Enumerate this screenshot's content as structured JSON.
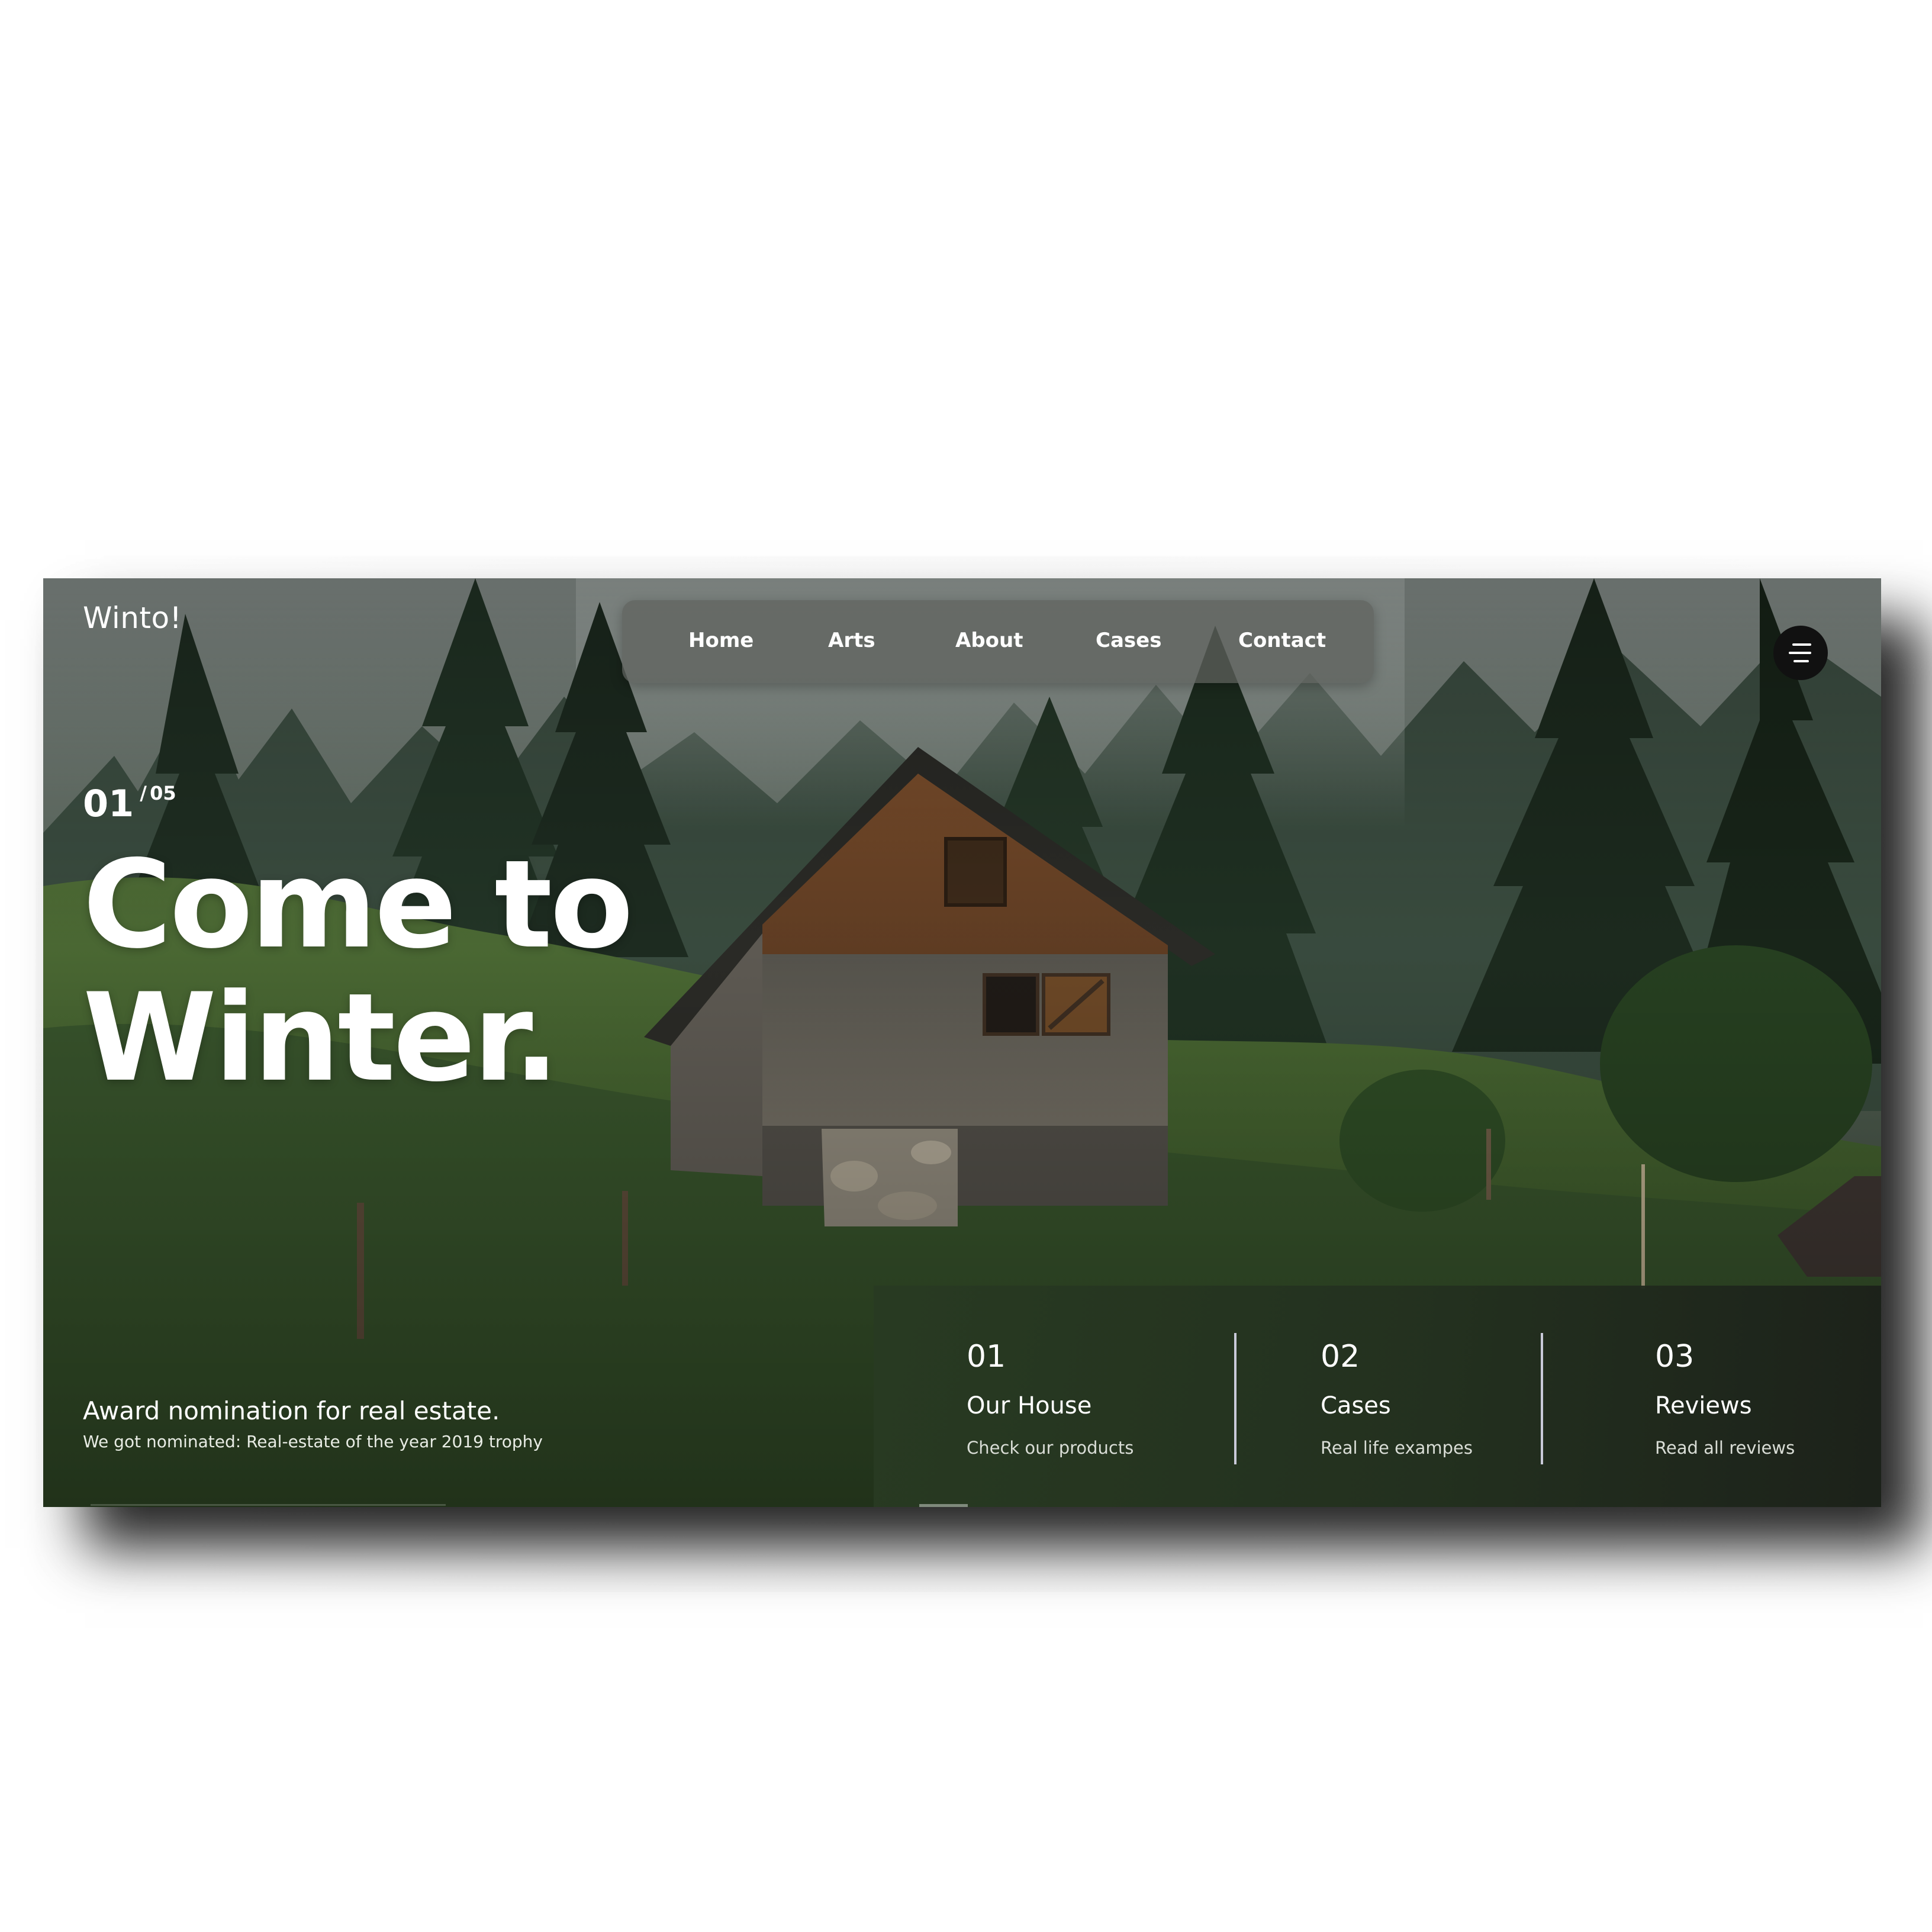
{
  "header": {
    "brand": "Winto!"
  },
  "nav": {
    "items": [
      {
        "label": "Home"
      },
      {
        "label": "Arts"
      },
      {
        "label": "About"
      },
      {
        "label": "Cases"
      },
      {
        "label": "Contact"
      }
    ]
  },
  "menu": {
    "icon": "menu-lines-icon"
  },
  "hero": {
    "slide_current": "01",
    "slide_separator": "/",
    "slide_total": "05",
    "headline_line1": "Come to",
    "headline_line2": "Winter."
  },
  "award": {
    "title": "Award nomination for real estate.",
    "subtitle": "We got nominated: Real-estate of the year 2019 trophy"
  },
  "cards": [
    {
      "number": "01",
      "title": "Our House",
      "description": "Check our products"
    },
    {
      "number": "02",
      "title": "Cases",
      "description": "Real life exampes"
    },
    {
      "number": "03",
      "title": "Reviews",
      "description": "Read all reviews"
    }
  ],
  "colors": {
    "text": "#ffffff",
    "nav_background": "#5f625e",
    "card_panel": "#283a22",
    "menu_button": "#111111",
    "divider": "#c9cad9"
  }
}
